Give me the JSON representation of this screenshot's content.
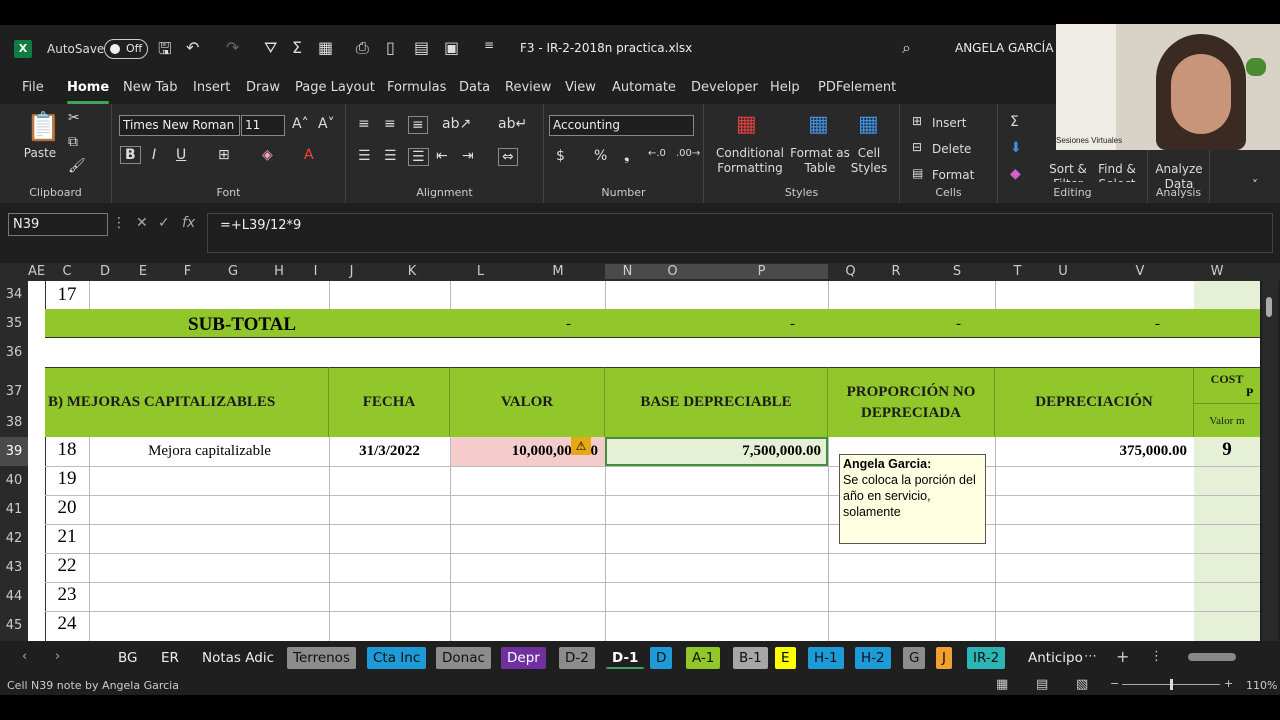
{
  "titlebar": {
    "autosave_label": "AutoSave",
    "autosave_state": "Off",
    "filename": "F3 - IR-2-2018n practica.xlsx",
    "user": "ANGELA GARCÍA"
  },
  "menu": [
    "File",
    "Home",
    "New Tab",
    "Insert",
    "Draw",
    "Page Layout",
    "Formulas",
    "Data",
    "Review",
    "View",
    "Automate",
    "Developer",
    "Help",
    "PDFelement"
  ],
  "ribbon": {
    "clipboard": {
      "paste": "Paste",
      "label": "Clipboard"
    },
    "font": {
      "name": "Times New Roman",
      "size": "11",
      "label": "Font"
    },
    "alignment": {
      "label": "Alignment"
    },
    "number": {
      "format": "Accounting",
      "label": "Number"
    },
    "styles": {
      "conditional": "Conditional\nFormatting",
      "format_table": "Format as\nTable",
      "cell_styles": "Cell\nStyles",
      "label": "Styles"
    },
    "cells": {
      "insert": "Insert",
      "delete": "Delete",
      "format": "Format",
      "label": "Cells"
    },
    "editing": {
      "sort": "Sort &\nFilter",
      "find": "Find &\nSelect",
      "label": "Editing"
    },
    "analysis": {
      "analyze": "Analyze\nData",
      "label": "Analysis"
    }
  },
  "formula_bar": {
    "name_box": "N39",
    "formula": "=+L39/12*9"
  },
  "columns": [
    "AE",
    "C",
    "D",
    "E",
    "F",
    "G",
    "H",
    "I",
    "J",
    "K",
    "L",
    "M",
    "N",
    "O",
    "P",
    "Q",
    "R",
    "S",
    "T",
    "U",
    "V",
    "W"
  ],
  "rows": [
    "34",
    "35",
    "36",
    "37",
    "38",
    "39",
    "40",
    "41",
    "42",
    "43",
    "44",
    "45"
  ],
  "sheet": {
    "row34_num": "17",
    "subtotal_label": "SUB-TOTAL",
    "subtotal_dash": "-",
    "section_header": "B) MEJORAS CAPITALIZABLES",
    "hdr_fecha": "FECHA",
    "hdr_valor": "VALOR",
    "hdr_base": "BASE DEPRECIABLE",
    "hdr_proporcion": "PROPORCIÓN NO DEPRECIADA",
    "hdr_depreciacion": "DEPRECIACIÓN",
    "hdr_cost": "COST",
    "hdr_cost2": "P",
    "hdr_valor_m": "Valor m",
    "row39": {
      "num": "18",
      "desc": "Mejora capitalizable",
      "fecha": "31/3/2022",
      "valor": "10,000,000.00",
      "base": "7,500,000.00",
      "depr": "375,000.00",
      "w": "9"
    },
    "nums": [
      "19",
      "20",
      "21",
      "22",
      "23",
      "24"
    ]
  },
  "note": {
    "author": "Angela Garcia:",
    "text": "Se coloca la porción del año en servicio, solamente"
  },
  "video_caption": "Sesiones Virtuales",
  "tabs": [
    {
      "label": "BG",
      "color": ""
    },
    {
      "label": "ER",
      "color": ""
    },
    {
      "label": "Notas Adic",
      "color": ""
    },
    {
      "label": "Terrenos",
      "color": "#8c8c8c"
    },
    {
      "label": "Cta Inc",
      "color": "#1e9bd7"
    },
    {
      "label": "Donac",
      "color": "#8c8c8c"
    },
    {
      "label": "Depr",
      "color": "#7030a0"
    },
    {
      "label": "D-2",
      "color": "#8c8c8c"
    },
    {
      "label": "D-1",
      "color": "#ffffff"
    },
    {
      "label": "D",
      "color": "#1e9bd7"
    },
    {
      "label": "A-1",
      "color": "#92c72b"
    },
    {
      "label": "B-1",
      "color": "#a6a6a6"
    },
    {
      "label": "E",
      "color": "#ffff00"
    },
    {
      "label": "H-1",
      "color": "#1e9bd7"
    },
    {
      "label": "H-2",
      "color": "#1e9bd7"
    },
    {
      "label": "G",
      "color": "#8c8c8c"
    },
    {
      "label": "J",
      "color": "#f0a030"
    },
    {
      "label": "IR-2",
      "color": "#2bb5b5"
    },
    {
      "label": "Anticipo",
      "color": ""
    }
  ],
  "status": {
    "left": "Cell N39 note by Angela Garcia",
    "zoom": "110%"
  }
}
